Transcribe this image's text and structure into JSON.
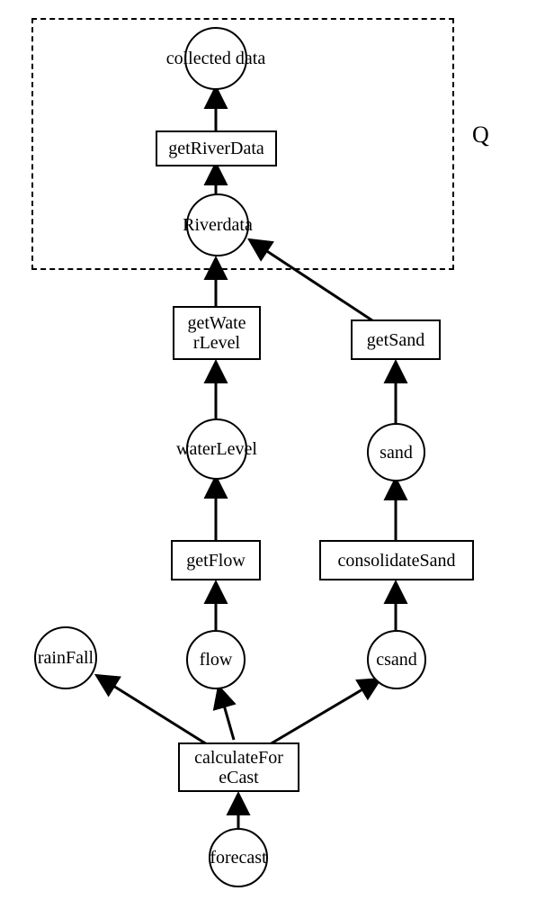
{
  "region_label": "Q",
  "nodes": {
    "collected_data": "collected data",
    "getRiverData": "getRiverData",
    "riverdata": "Riverdata",
    "getWaterLevel": "getWate\nrLevel",
    "getSand": "getSand",
    "waterLevel": "waterLevel",
    "sand": "sand",
    "getFlow": "getFlow",
    "consolidateSand": "consolidateSand",
    "rainFall": "rainFall",
    "flow": "flow",
    "csand": "csand",
    "calculateForeCast": "calculateFor\neCast",
    "forecast": "forecast"
  }
}
